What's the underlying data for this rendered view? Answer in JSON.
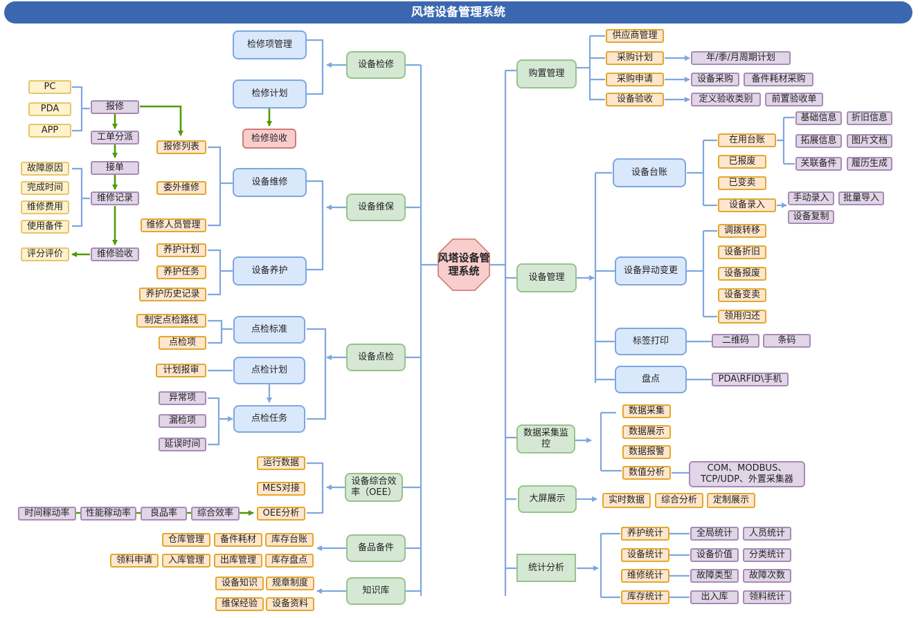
{
  "title": "风塔设备管理系统",
  "center": "风塔设备管理系统",
  "colors": {
    "header": "#3a67b0",
    "connector": "#7ea6e0",
    "flow_arrow": "#4e9a06"
  },
  "left": {
    "inspection": {
      "label": "设备检修",
      "children": [
        "检修项管理",
        "检修计划"
      ],
      "acceptance": "检修验收"
    },
    "repair_flow": {
      "sources": [
        "PC",
        "PDA",
        "APP"
      ],
      "report": "报修",
      "dispatch": "工单分派",
      "accept": "接单",
      "record": "维修记录",
      "record_fields": [
        "故障原因",
        "完成时间",
        "维修费用",
        "使用备件"
      ],
      "acceptance": "维修验收",
      "rating": "评分评价",
      "report_list": "报修列表"
    },
    "maintenance": {
      "label": "设备维保",
      "repair": {
        "label": "设备维修",
        "items": [
          "报修列表",
          "委外维修",
          "维修人员管理"
        ]
      },
      "upkeep": {
        "label": "设备养护",
        "items": [
          "养护计划",
          "养护任务",
          "养护历史记录"
        ]
      }
    },
    "spot_check": {
      "label": "设备点检",
      "standard": {
        "label": "点检标准",
        "items": [
          "制定点检路线",
          "点检项"
        ]
      },
      "plan": {
        "label": "点检计划",
        "items": [
          "计划报审"
        ]
      },
      "task": {
        "label": "点检任务",
        "items": [
          "异常项",
          "漏检项",
          "延误时间"
        ]
      }
    },
    "oee": {
      "label": "设备综合效率（OEE）",
      "items": [
        "运行数据",
        "MES对接",
        "OEE分析"
      ],
      "chain": [
        "时间稼动率",
        "性能稼动率",
        "良品率",
        "综合效率"
      ]
    },
    "spares": {
      "label": "备品备件",
      "row1": [
        "仓库管理",
        "备件耗材",
        "库存台账"
      ],
      "row2": [
        "领料申请",
        "入库管理",
        "出库管理",
        "库存盘点"
      ]
    },
    "knowledge": {
      "label": "知识库",
      "row1": [
        "设备知识",
        "规章制度"
      ],
      "row2": [
        "维保经验",
        "设备资料"
      ]
    }
  },
  "right": {
    "purchase": {
      "label": "购置管理",
      "items": [
        "供应商管理",
        "采购计划",
        "采购申请",
        "设备验收"
      ],
      "plan_detail": [
        "年/季/月周期计划"
      ],
      "request_detail": [
        "设备采购",
        "备件耗材采购"
      ],
      "accept_detail": [
        "定义验收类别",
        "前置验收单"
      ]
    },
    "device_mgmt": {
      "label": "设备管理",
      "ledger": {
        "label": "设备台账",
        "states": [
          "在用台账",
          "已报废",
          "已变卖",
          "设备录入"
        ],
        "inuse_detail": [
          "基础信息",
          "折旧信息",
          "拓展信息",
          "图片文档",
          "关联备件",
          "履历生成"
        ],
        "entry_detail": [
          "手动录入",
          "批量导入",
          "设备复制"
        ]
      },
      "change": {
        "label": "设备异动变更",
        "items": [
          "调拨转移",
          "设备折旧",
          "设备报废",
          "设备变卖",
          "领用归还"
        ]
      },
      "label_print": {
        "label": "标签打印",
        "items": [
          "二维码",
          "条码"
        ]
      },
      "inventory": {
        "label": "盘点",
        "items": [
          "PDA\\RFID\\手机"
        ]
      }
    },
    "data_collect": {
      "label": "数据采集监控",
      "items": [
        "数据采集",
        "数据展示",
        "数据报警",
        "数值分析"
      ],
      "analysis_detail": "COM、MODBUS、TCP/UDP、外置采集器"
    },
    "big_screen": {
      "label": "大屏展示",
      "items": [
        "实时数据",
        "综合分析",
        "定制展示"
      ]
    },
    "statistics": {
      "label": "统计分析",
      "rows": [
        {
          "label": "养护统计",
          "items": [
            "全局统计",
            "人员统计"
          ]
        },
        {
          "label": "设备统计",
          "items": [
            "设备价值",
            "分类统计"
          ]
        },
        {
          "label": "维修统计",
          "items": [
            "故障类型",
            "故障次数"
          ]
        },
        {
          "label": "库存统计",
          "items": [
            "出入库",
            "领料统计"
          ]
        }
      ]
    }
  }
}
